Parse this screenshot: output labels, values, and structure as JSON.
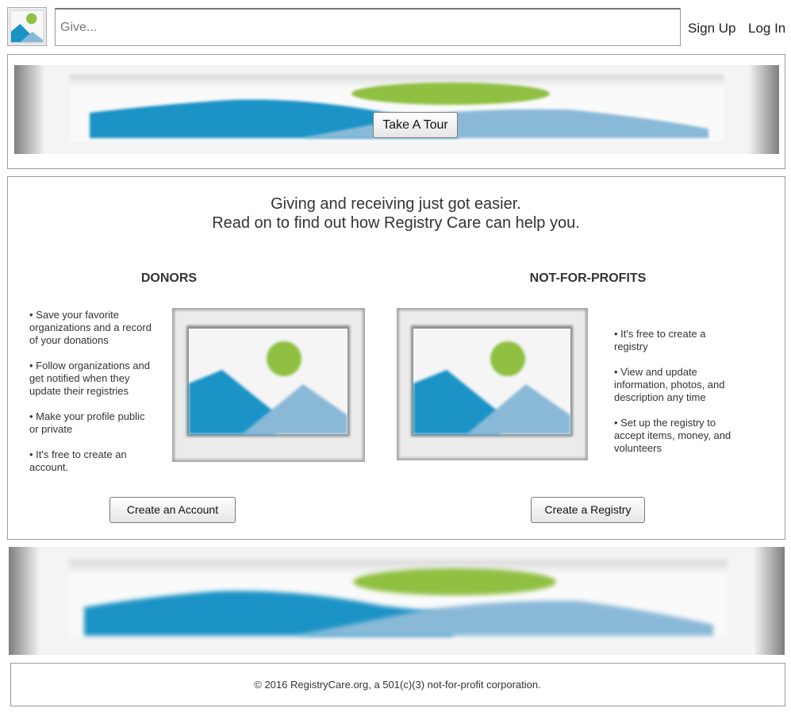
{
  "header": {
    "logo_icon": "image-placeholder-icon",
    "search_placeholder": "Give...",
    "signup_label": "Sign Up",
    "login_label": "Log In"
  },
  "hero": {
    "tour_button_label": "Take A Tour"
  },
  "intro": {
    "line1": "Giving and receiving just got easier.",
    "line2": "Read on to find out how Registry Care can help you."
  },
  "donors": {
    "title": "DONORS",
    "bullets": [
      "• Save your favorite organizations and a record of your donations",
      "• Follow organizations and get notified when they update their registries",
      "•  Make your profile public or private",
      "• It's free to create an account."
    ],
    "button_label": "Create an Account"
  },
  "nonprofits": {
    "title": "NOT-FOR-PROFITS",
    "bullets": [
      "• It's free to create a registry",
      "• View and update information, photos, and description any time",
      "•  Set up the registry to accept items, money, and volunteers"
    ],
    "button_label": "Create a Registry"
  },
  "footer": {
    "copyright": "© 2016 RegistryCare.org, a 501(c)(3) not-for-profit corporation."
  },
  "colors": {
    "sky_blue": "#1a93c6",
    "light_blue": "#8ab9d8",
    "sun_green": "#8fc043",
    "frame_gray": "#9a9a9a"
  }
}
